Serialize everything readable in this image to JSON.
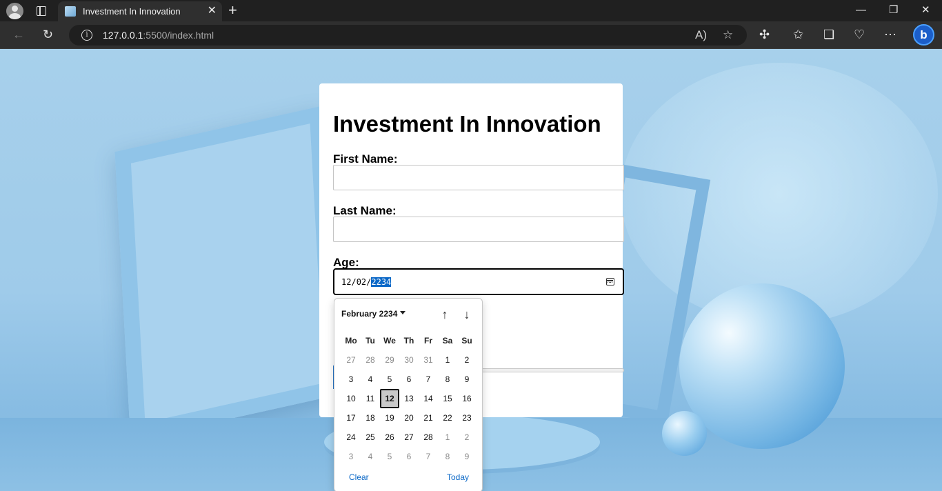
{
  "browser": {
    "tab_title": "Investment In Innovation",
    "tab_close": "✕",
    "new_tab": "+",
    "url_host": "127.0.0.1",
    "url_rest": ":5500/index.html",
    "info_glyph": "i",
    "window_minimize": "—",
    "window_restore": "❐",
    "window_close": "✕"
  },
  "form": {
    "title": "Investment In Innovation",
    "first_name_label": "First Name:",
    "first_name_value": "",
    "last_name_label": "Last Name:",
    "last_name_value": "",
    "age_label": "Age:",
    "age_value": {
      "month": "12",
      "sep1": "/",
      "day": "02",
      "sep2": "/",
      "year": "2234"
    }
  },
  "date_picker": {
    "month_label": "February 2234",
    "prev_arrow": "↑",
    "next_arrow": "↓",
    "weekdays": [
      "Mo",
      "Tu",
      "We",
      "Th",
      "Fr",
      "Sa",
      "Su"
    ],
    "weeks": [
      [
        {
          "d": "27",
          "out": true
        },
        {
          "d": "28",
          "out": true
        },
        {
          "d": "29",
          "out": true
        },
        {
          "d": "30",
          "out": true
        },
        {
          "d": "31",
          "out": true
        },
        {
          "d": "1"
        },
        {
          "d": "2"
        }
      ],
      [
        {
          "d": "3"
        },
        {
          "d": "4"
        },
        {
          "d": "5"
        },
        {
          "d": "6"
        },
        {
          "d": "7"
        },
        {
          "d": "8"
        },
        {
          "d": "9"
        }
      ],
      [
        {
          "d": "10"
        },
        {
          "d": "11"
        },
        {
          "d": "12",
          "selected": true
        },
        {
          "d": "13"
        },
        {
          "d": "14"
        },
        {
          "d": "15"
        },
        {
          "d": "16"
        }
      ],
      [
        {
          "d": "17"
        },
        {
          "d": "18"
        },
        {
          "d": "19"
        },
        {
          "d": "20"
        },
        {
          "d": "21"
        },
        {
          "d": "22"
        },
        {
          "d": "23"
        }
      ],
      [
        {
          "d": "24"
        },
        {
          "d": "25"
        },
        {
          "d": "26"
        },
        {
          "d": "27"
        },
        {
          "d": "28"
        },
        {
          "d": "1",
          "out": true
        },
        {
          "d": "2",
          "out": true
        }
      ],
      [
        {
          "d": "3",
          "out": true
        },
        {
          "d": "4",
          "out": true
        },
        {
          "d": "5",
          "out": true
        },
        {
          "d": "6",
          "out": true
        },
        {
          "d": "7",
          "out": true
        },
        {
          "d": "8",
          "out": true
        },
        {
          "d": "9",
          "out": true
        }
      ]
    ],
    "clear_label": "Clear",
    "today_label": "Today"
  }
}
